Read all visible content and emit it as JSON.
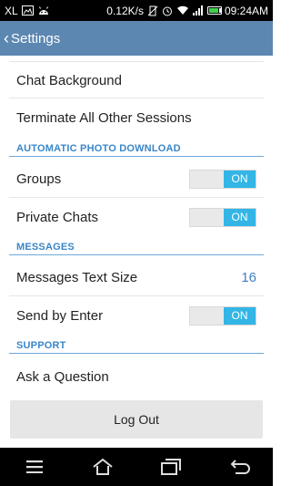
{
  "statusbar": {
    "carrier": "XL",
    "speed": "0.12K/s",
    "battery_level": 0.7,
    "time": "09:24AM"
  },
  "actionbar": {
    "title": "Settings"
  },
  "rows": {
    "chat_background": "Chat Background",
    "terminate_sessions": "Terminate All Other Sessions",
    "groups": "Groups",
    "private_chats": "Private Chats",
    "messages_text_size": "Messages Text Size",
    "messages_text_size_value": "16",
    "send_by_enter": "Send by Enter",
    "ask_question": "Ask a Question"
  },
  "sections": {
    "auto_photo": "AUTOMATIC PHOTO DOWNLOAD",
    "messages": "MESSAGES",
    "support": "SUPPORT"
  },
  "toggles": {
    "groups": "ON",
    "private_chats": "ON",
    "send_by_enter": "ON"
  },
  "logout_label": "Log Out",
  "colors": {
    "actionbar": "#5c87b1",
    "section_text": "#3a86c8",
    "toggle_on": "#33b5e5",
    "value_text": "#3f7fc0"
  },
  "icons": {
    "status_left": [
      "image-icon",
      "android-icon"
    ],
    "status_right": [
      "mute-vibrate-icon",
      "alarm-icon",
      "wifi-icon",
      "signal-icon",
      "battery-icon"
    ],
    "nav": [
      "menu-icon",
      "home-icon",
      "recent-apps-icon",
      "back-icon"
    ]
  }
}
